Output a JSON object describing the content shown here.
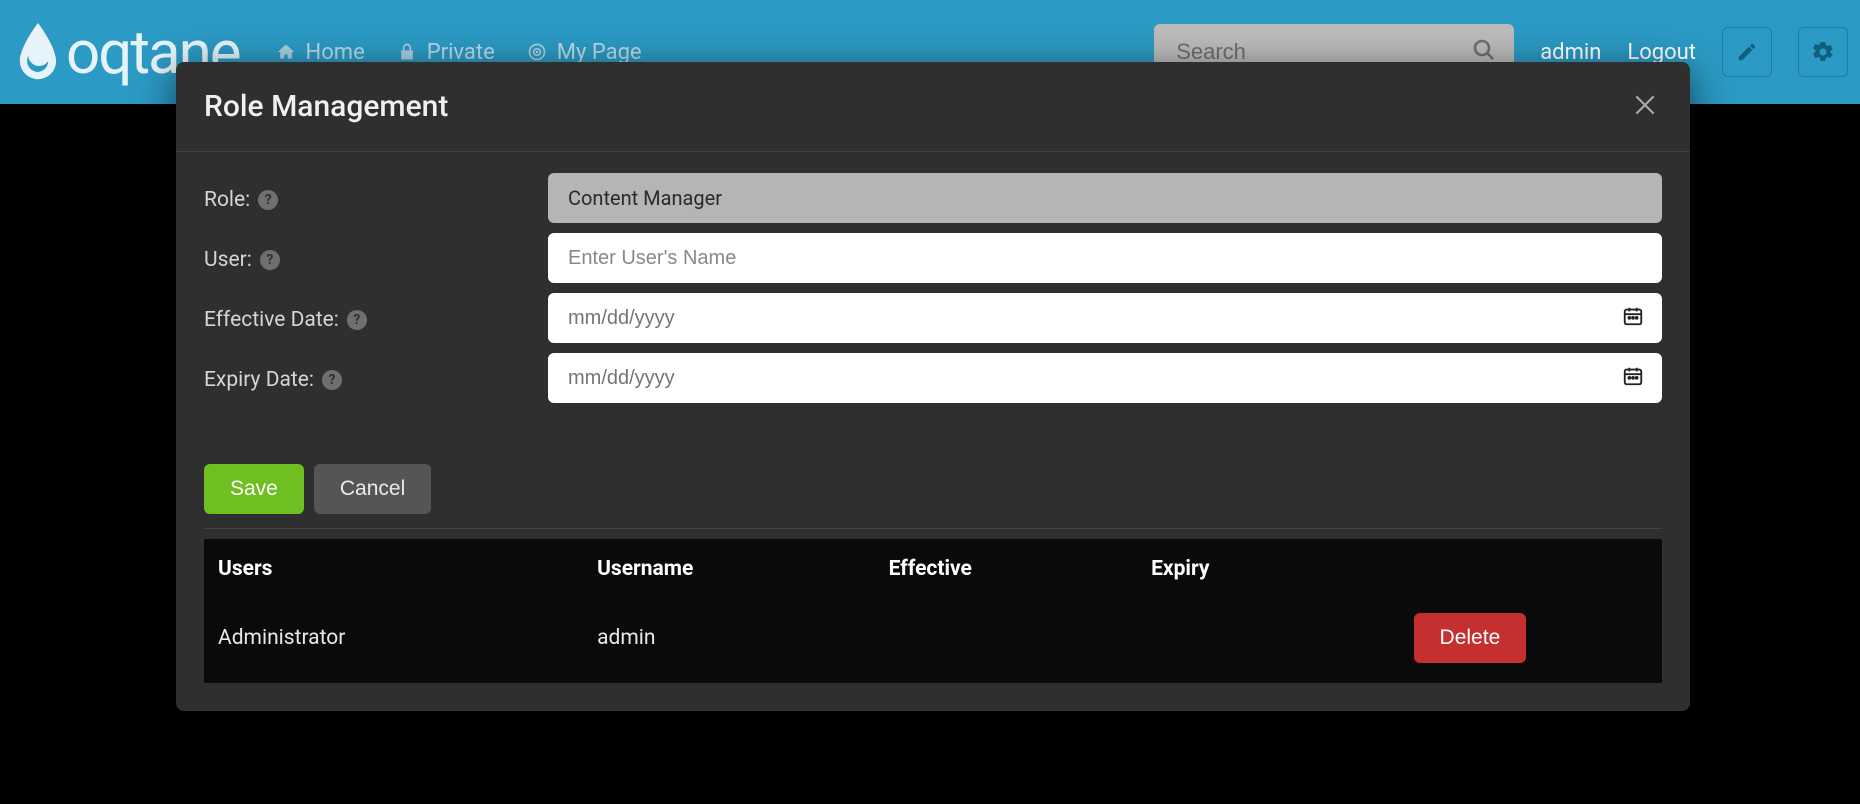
{
  "brand": {
    "text": "oqtane"
  },
  "nav": {
    "items": [
      {
        "label": "Home",
        "icon": "home-icon"
      },
      {
        "label": "Private",
        "icon": "lock-icon"
      },
      {
        "label": "My Page",
        "icon": "target-icon"
      }
    ]
  },
  "search": {
    "placeholder": "Search"
  },
  "user_links": {
    "admin": "admin",
    "logout": "Logout"
  },
  "modal": {
    "title": "Role Management",
    "fields": {
      "role": {
        "label": "Role:",
        "value": "Content Manager"
      },
      "user": {
        "label": "User:",
        "placeholder": "Enter User's Name"
      },
      "effective": {
        "label": "Effective Date:",
        "placeholder": "mm/dd/yyyy"
      },
      "expiry": {
        "label": "Expiry Date:",
        "placeholder": "mm/dd/yyyy"
      }
    },
    "buttons": {
      "save": "Save",
      "cancel": "Cancel"
    },
    "table": {
      "headers": {
        "users": "Users",
        "username": "Username",
        "effective": "Effective",
        "expiry": "Expiry"
      },
      "rows": [
        {
          "users": "Administrator",
          "username": "admin",
          "effective": "",
          "expiry": "",
          "action": "Delete"
        }
      ]
    }
  }
}
